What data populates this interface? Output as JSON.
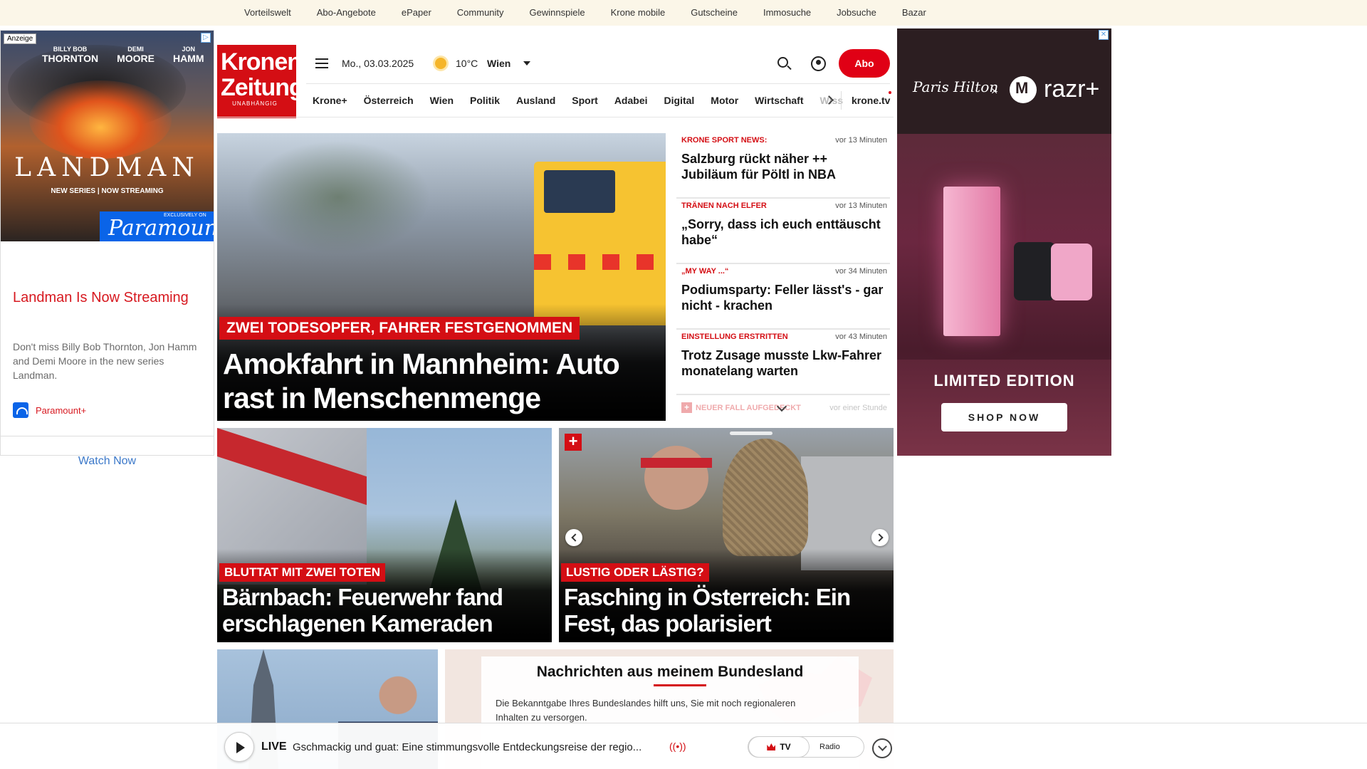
{
  "topnav": [
    "Vorteilswelt",
    "Abo-Angebote",
    "ePaper",
    "Community",
    "Gewinnspiele",
    "Krone mobile",
    "Gutscheine",
    "Immosuche",
    "Jobsuche",
    "Bazar"
  ],
  "ad_left": {
    "tag": "Anzeige",
    "cast": [
      {
        "first": "BILLY BOB",
        "last": "THORNTON"
      },
      {
        "first": "DEMI",
        "last": "MOORE"
      },
      {
        "first": "JON",
        "last": "HAMM"
      }
    ],
    "show": "LANDMAN",
    "show_sub": "NEW SERIES | NOW STREAMING",
    "badge_small": "EXCLUSIVELY ON",
    "badge": "Paramount+",
    "title": "Landman Is Now Streaming",
    "description": "Don't miss Billy Bob Thornton, Jon Hamm and Demi Moore in the new series Landman.",
    "brand": "Paramount+",
    "cta": "Watch Now"
  },
  "ad_right": {
    "signature": "Paris Hilton",
    "times": "×",
    "brand": "razr+",
    "edition": "LIMITED EDITION",
    "cta": "SHOP NOW"
  },
  "header": {
    "logo_line1": "Kronen",
    "logo_line2": "Zeitung",
    "logo_sub": "UNABHÄNGIG",
    "date": "Mo., 03.03.2025",
    "temperature": "10°C",
    "city": "Wien",
    "abo": "Abo",
    "nav": [
      "Krone+",
      "Österreich",
      "Wien",
      "Politik",
      "Ausland",
      "Sport",
      "Adabei",
      "Digital",
      "Motor",
      "Wirtschaft",
      "Wiss"
    ],
    "krone_tv": "krone.tv"
  },
  "main_story": {
    "kicker": "ZWEI TODESOPFER, FAHRER FESTGENOMMEN",
    "headline": "Amokfahrt in Mannheim: Auto rast in Menschenmenge"
  },
  "news": [
    {
      "category": "KRONE SPORT NEWS:",
      "time": "vor 13 Minuten",
      "title": "Salzburg rückt näher ++ Jubiläum für Pöltl in NBA"
    },
    {
      "category": "TRÄNEN NACH ELFER",
      "time": "vor 13 Minuten",
      "title": "„Sorry, dass ich euch enttäuscht habe“"
    },
    {
      "category": "„MY WAY ...“",
      "time": "vor 34 Minuten",
      "title": "Podiumsparty: Feller lässt's - gar nicht - krachen"
    },
    {
      "category": "EINSTELLUNG ERSTRITTEN",
      "time": "vor 43 Minuten",
      "title": "Trotz Zusage musste Lkw-Fahrer monatelang warten"
    }
  ],
  "news_more": {
    "category": "NEUER FALL AUFGEDECKT",
    "time": "vor einer Stunde"
  },
  "cards": [
    {
      "kicker": "BLUTTAT MIT ZWEI TOTEN",
      "headline": "Bärnbach: Feuerwehr fand erschlagenen Kameraden"
    },
    {
      "kicker": "LUSTIG ODER LÄSTIG?",
      "headline": "Fasching in Österreich: Ein Fest, das polarisiert",
      "badge": "+"
    }
  ],
  "bundesland": {
    "title": "Nachrichten aus meinem Bundesland",
    "text": "Die Bekanntgabe Ihres Bundeslandes hilft uns, Sie mit noch regionaleren Inhalten zu versorgen."
  },
  "player": {
    "live": "LIVE",
    "title": "Gschmackig und guat: Eine stimmungsvolle Entdeckungsreise der regio...",
    "radio_icon": "((•))",
    "tv": "TV",
    "radio": "Radio"
  },
  "colors": {
    "brand_red": "#d40e14",
    "abo_red": "#e00015",
    "topbar_bg": "#fbf6e8"
  }
}
